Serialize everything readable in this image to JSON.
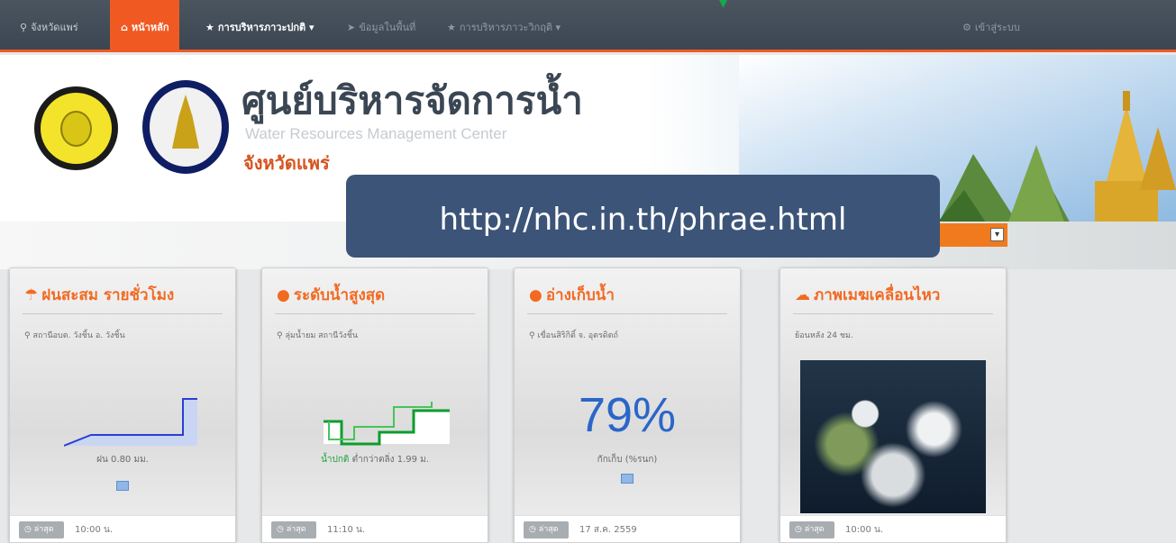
{
  "nav": {
    "items": [
      {
        "label": "จังหวัดแพร่",
        "icon": "map-marker-icon"
      },
      {
        "label": "หน้าหลัก",
        "icon": "home-icon"
      },
      {
        "label": "การบริหารภาวะปกติ",
        "icon": "star-icon"
      },
      {
        "label": "ข้อมูลในพื้นที่",
        "icon": "send-icon"
      },
      {
        "label": "การบริหารภาวะวิกฤติ",
        "icon": "star-icon"
      }
    ],
    "right_label": "เข้าสู่ระบบ",
    "right_icon": "gear-icon"
  },
  "header": {
    "title_th": "ศูนย์บริหารจัดการน้ำ",
    "title_en": "Water Resources Management Center",
    "province": "จังหวัดแพร่"
  },
  "overlay": {
    "url": "http://nhc.in.th/phrae.html"
  },
  "cards": [
    {
      "title": "ฝนสะสม รายชั่วโมง",
      "icon": "umbrella-icon",
      "station": "สถานีอบต. วังชิ้น อ. วังชิ้น",
      "caption": "ฝน 0.80 มม.",
      "badge": "ล่าสุด",
      "time": "10:00 น."
    },
    {
      "title": "ระดับน้ำสูงสุด",
      "icon": "drop-icon",
      "station": "ลุ่มน้ำยม สถานีวังชิ้น",
      "caption_prefix": "น้ำปกติ",
      "caption": "ต่ำกว่าตลิ่ง 1.99 ม.",
      "badge": "ล่าสุด",
      "time": "11:10 น."
    },
    {
      "title": "อ่างเก็บน้ำ",
      "icon": "drop-icon",
      "station": "เขื่อนสิริกิติ์ จ. อุตรดิตถ์",
      "percent": "79%",
      "caption": "กักเก็บ (%รนก)",
      "badge": "ล่าสุด",
      "time": "17 ส.ค. 2559"
    },
    {
      "title": "ภาพเมฆเคลื่อนไหว",
      "icon": "cloud-icon",
      "station": "ย้อนหลัง 24 ชม.",
      "badge": "ล่าสุด",
      "time": "10:00 น."
    }
  ],
  "colors": {
    "nav_bg": "#3b4652",
    "accent": "#f05a22",
    "url_box": "#3c5478",
    "percent_blue": "#2b66c8"
  }
}
